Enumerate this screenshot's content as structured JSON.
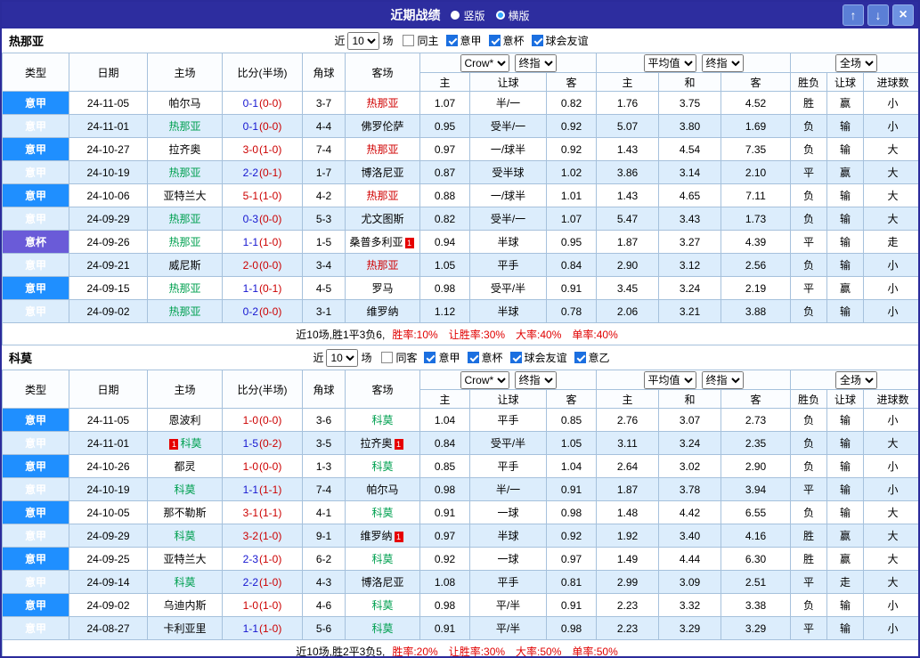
{
  "titlebar": {
    "title": "近期战绩",
    "view_options": [
      {
        "label": "竖版",
        "selected": false
      },
      {
        "label": "横版",
        "selected": true
      }
    ],
    "up_icon": "↑",
    "down_icon": "↓",
    "close_icon": "×"
  },
  "columns": {
    "main": [
      "类型",
      "日期",
      "主场",
      "比分(半场)",
      "角球",
      "客场"
    ],
    "sub": [
      "主",
      "让球",
      "客",
      "主",
      "和",
      "客",
      "胜负",
      "让球",
      "进球数"
    ]
  },
  "sections": [
    {
      "team": "热那亚",
      "filter": {
        "prefix": "近",
        "count": "10",
        "suffix": "场",
        "checkboxes": [
          {
            "label": "同主",
            "checked": false
          },
          {
            "label": "意甲",
            "checked": true
          },
          {
            "label": "意杯",
            "checked": true
          },
          {
            "label": "球会友谊",
            "checked": true
          }
        ]
      },
      "dropdowns": {
        "source": "Crow*",
        "period1": "终指",
        "average": "平均值",
        "period2": "终指",
        "scope": "全场"
      },
      "rows": [
        {
          "type": "意甲",
          "type_color": "blue",
          "date": "24-11-05",
          "home": "帕尔马",
          "home_color": "black",
          "home_badge": null,
          "score_ft": "0-1",
          "score_ht": "(0-0)",
          "ft_color": "blue",
          "corner": "3-7",
          "away": "热那亚",
          "away_color": "red",
          "away_badge": null,
          "odds": [
            "1.07",
            "半/一",
            "0.82"
          ],
          "avg": [
            "1.76",
            "3.75",
            "4.52"
          ],
          "results": [
            {
              "text": "胜",
              "color": "red"
            },
            {
              "text": "赢",
              "color": "red"
            },
            {
              "text": "小",
              "color": "green"
            }
          ]
        },
        {
          "type": "意甲",
          "type_color": "blue",
          "date": "24-11-01",
          "home": "热那亚",
          "home_color": "green",
          "home_badge": null,
          "score_ft": "0-1",
          "score_ht": "(0-0)",
          "ft_color": "blue",
          "corner": "4-4",
          "away": "佛罗伦萨",
          "away_color": "black",
          "away_badge": null,
          "odds": [
            "0.95",
            "受半/一",
            "0.92"
          ],
          "avg": [
            "5.07",
            "3.80",
            "1.69"
          ],
          "results": [
            {
              "text": "负",
              "color": "green"
            },
            {
              "text": "输",
              "color": "green"
            },
            {
              "text": "小",
              "color": "green"
            }
          ]
        },
        {
          "type": "意甲",
          "type_color": "blue",
          "date": "24-10-27",
          "home": "拉齐奥",
          "home_color": "black",
          "home_badge": null,
          "score_ft": "3-0",
          "score_ht": "(1-0)",
          "ft_color": "red",
          "corner": "7-4",
          "away": "热那亚",
          "away_color": "red",
          "away_badge": null,
          "odds": [
            "0.97",
            "一/球半",
            "0.92"
          ],
          "avg": [
            "1.43",
            "4.54",
            "7.35"
          ],
          "results": [
            {
              "text": "负",
              "color": "green"
            },
            {
              "text": "输",
              "color": "green"
            },
            {
              "text": "大",
              "color": "red"
            }
          ]
        },
        {
          "type": "意甲",
          "type_color": "blue",
          "date": "24-10-19",
          "home": "热那亚",
          "home_color": "green",
          "home_badge": null,
          "score_ft": "2-2",
          "score_ht": "(0-1)",
          "ft_color": "blue",
          "corner": "1-7",
          "away": "博洛尼亚",
          "away_color": "black",
          "away_badge": null,
          "odds": [
            "0.87",
            "受半球",
            "1.02"
          ],
          "avg": [
            "3.86",
            "3.14",
            "2.10"
          ],
          "results": [
            {
              "text": "平",
              "color": "blue"
            },
            {
              "text": "赢",
              "color": "red"
            },
            {
              "text": "大",
              "color": "red"
            }
          ]
        },
        {
          "type": "意甲",
          "type_color": "blue",
          "date": "24-10-06",
          "home": "亚特兰大",
          "home_color": "black",
          "home_badge": null,
          "score_ft": "5-1",
          "score_ht": "(1-0)",
          "ft_color": "red",
          "corner": "4-2",
          "away": "热那亚",
          "away_color": "red",
          "away_badge": null,
          "odds": [
            "0.88",
            "一/球半",
            "1.01"
          ],
          "avg": [
            "1.43",
            "4.65",
            "7.11"
          ],
          "results": [
            {
              "text": "负",
              "color": "green"
            },
            {
              "text": "输",
              "color": "green"
            },
            {
              "text": "大",
              "color": "red"
            }
          ]
        },
        {
          "type": "意甲",
          "type_color": "blue",
          "date": "24-09-29",
          "home": "热那亚",
          "home_color": "green",
          "home_badge": null,
          "score_ft": "0-3",
          "score_ht": "(0-0)",
          "ft_color": "blue",
          "corner": "5-3",
          "away": "尤文图斯",
          "away_color": "black",
          "away_badge": null,
          "odds": [
            "0.82",
            "受半/一",
            "1.07"
          ],
          "avg": [
            "5.47",
            "3.43",
            "1.73"
          ],
          "results": [
            {
              "text": "负",
              "color": "green"
            },
            {
              "text": "输",
              "color": "green"
            },
            {
              "text": "大",
              "color": "red"
            }
          ]
        },
        {
          "type": "意杯",
          "type_color": "purple",
          "date": "24-09-26",
          "home": "热那亚",
          "home_color": "green",
          "home_badge": null,
          "score_ft": "1-1",
          "score_ht": "(1-0)",
          "ft_color": "blue",
          "corner": "1-5",
          "away": "桑普多利亚",
          "away_color": "black",
          "away_badge": "1",
          "odds": [
            "0.94",
            "半球",
            "0.95"
          ],
          "avg": [
            "1.87",
            "3.27",
            "4.39"
          ],
          "results": [
            {
              "text": "平",
              "color": "blue"
            },
            {
              "text": "输",
              "color": "green"
            },
            {
              "text": "走",
              "color": "blue"
            }
          ]
        },
        {
          "type": "意甲",
          "type_color": "blue",
          "date": "24-09-21",
          "home": "威尼斯",
          "home_color": "black",
          "home_badge": null,
          "score_ft": "2-0",
          "score_ht": "(0-0)",
          "ft_color": "red",
          "corner": "3-4",
          "away": "热那亚",
          "away_color": "red",
          "away_badge": null,
          "odds": [
            "1.05",
            "平手",
            "0.84"
          ],
          "avg": [
            "2.90",
            "3.12",
            "2.56"
          ],
          "results": [
            {
              "text": "负",
              "color": "green"
            },
            {
              "text": "输",
              "color": "green"
            },
            {
              "text": "小",
              "color": "green"
            }
          ]
        },
        {
          "type": "意甲",
          "type_color": "blue",
          "date": "24-09-15",
          "home": "热那亚",
          "home_color": "green",
          "home_badge": null,
          "score_ft": "1-1",
          "score_ht": "(0-1)",
          "ft_color": "blue",
          "corner": "4-5",
          "away": "罗马",
          "away_color": "black",
          "away_badge": null,
          "odds": [
            "0.98",
            "受平/半",
            "0.91"
          ],
          "avg": [
            "3.45",
            "3.24",
            "2.19"
          ],
          "results": [
            {
              "text": "平",
              "color": "blue"
            },
            {
              "text": "赢",
              "color": "red"
            },
            {
              "text": "小",
              "color": "green"
            }
          ]
        },
        {
          "type": "意甲",
          "type_color": "blue",
          "date": "24-09-02",
          "home": "热那亚",
          "home_color": "green",
          "home_badge": null,
          "score_ft": "0-2",
          "score_ht": "(0-0)",
          "ft_color": "blue",
          "corner": "3-1",
          "away": "维罗纳",
          "away_color": "black",
          "away_badge": null,
          "odds": [
            "1.12",
            "半球",
            "0.78"
          ],
          "avg": [
            "2.06",
            "3.21",
            "3.88"
          ],
          "results": [
            {
              "text": "负",
              "color": "green"
            },
            {
              "text": "输",
              "color": "green"
            },
            {
              "text": "小",
              "color": "green"
            }
          ]
        }
      ],
      "summary": {
        "prefix": "近10场,胜1平3负6,",
        "rates": [
          "胜率:10%",
          "让胜率:30%",
          "大率:40%",
          "单率:40%"
        ]
      }
    },
    {
      "team": "科莫",
      "filter": {
        "prefix": "近",
        "count": "10",
        "suffix": "场",
        "checkboxes": [
          {
            "label": "同客",
            "checked": false
          },
          {
            "label": "意甲",
            "checked": true
          },
          {
            "label": "意杯",
            "checked": true
          },
          {
            "label": "球会友谊",
            "checked": true
          },
          {
            "label": "意乙",
            "checked": true
          }
        ]
      },
      "dropdowns": {
        "source": "Crow*",
        "period1": "终指",
        "average": "平均值",
        "period2": "终指",
        "scope": "全场"
      },
      "rows": [
        {
          "type": "意甲",
          "type_color": "blue",
          "date": "24-11-05",
          "home": "恩波利",
          "home_color": "black",
          "home_badge": null,
          "score_ft": "1-0",
          "score_ht": "(0-0)",
          "ft_color": "red",
          "corner": "3-6",
          "away": "科莫",
          "away_color": "green",
          "away_badge": null,
          "odds": [
            "1.04",
            "平手",
            "0.85"
          ],
          "avg": [
            "2.76",
            "3.07",
            "2.73"
          ],
          "results": [
            {
              "text": "负",
              "color": "green"
            },
            {
              "text": "输",
              "color": "green"
            },
            {
              "text": "小",
              "color": "green"
            }
          ]
        },
        {
          "type": "意甲",
          "type_color": "blue",
          "date": "24-11-01",
          "home": "科莫",
          "home_color": "green",
          "home_badge": "1",
          "score_ft": "1-5",
          "score_ht": "(0-2)",
          "ft_color": "blue",
          "corner": "3-5",
          "away": "拉齐奥",
          "away_color": "black",
          "away_badge": "1",
          "odds": [
            "0.84",
            "受平/半",
            "1.05"
          ],
          "avg": [
            "3.11",
            "3.24",
            "2.35"
          ],
          "results": [
            {
              "text": "负",
              "color": "green"
            },
            {
              "text": "输",
              "color": "green"
            },
            {
              "text": "大",
              "color": "red"
            }
          ]
        },
        {
          "type": "意甲",
          "type_color": "blue",
          "date": "24-10-26",
          "home": "都灵",
          "home_color": "black",
          "home_badge": null,
          "score_ft": "1-0",
          "score_ht": "(0-0)",
          "ft_color": "red",
          "corner": "1-3",
          "away": "科莫",
          "away_color": "green",
          "away_badge": null,
          "odds": [
            "0.85",
            "平手",
            "1.04"
          ],
          "avg": [
            "2.64",
            "3.02",
            "2.90"
          ],
          "results": [
            {
              "text": "负",
              "color": "green"
            },
            {
              "text": "输",
              "color": "green"
            },
            {
              "text": "小",
              "color": "green"
            }
          ]
        },
        {
          "type": "意甲",
          "type_color": "blue",
          "date": "24-10-19",
          "home": "科莫",
          "home_color": "green",
          "home_badge": null,
          "score_ft": "1-1",
          "score_ht": "(1-1)",
          "ft_color": "blue",
          "corner": "7-4",
          "away": "帕尔马",
          "away_color": "black",
          "away_badge": null,
          "odds": [
            "0.98",
            "半/一",
            "0.91"
          ],
          "avg": [
            "1.87",
            "3.78",
            "3.94"
          ],
          "results": [
            {
              "text": "平",
              "color": "blue"
            },
            {
              "text": "输",
              "color": "green"
            },
            {
              "text": "小",
              "color": "green"
            }
          ]
        },
        {
          "type": "意甲",
          "type_color": "blue",
          "date": "24-10-05",
          "home": "那不勒斯",
          "home_color": "black",
          "home_badge": null,
          "score_ft": "3-1",
          "score_ht": "(1-1)",
          "ft_color": "red",
          "corner": "4-1",
          "away": "科莫",
          "away_color": "green",
          "away_badge": null,
          "odds": [
            "0.91",
            "一球",
            "0.98"
          ],
          "avg": [
            "1.48",
            "4.42",
            "6.55"
          ],
          "results": [
            {
              "text": "负",
              "color": "green"
            },
            {
              "text": "输",
              "color": "green"
            },
            {
              "text": "大",
              "color": "red"
            }
          ]
        },
        {
          "type": "意甲",
          "type_color": "blue",
          "date": "24-09-29",
          "home": "科莫",
          "home_color": "green",
          "home_badge": null,
          "score_ft": "3-2",
          "score_ht": "(1-0)",
          "ft_color": "red",
          "corner": "9-1",
          "away": "维罗纳",
          "away_color": "black",
          "away_badge": "1",
          "odds": [
            "0.97",
            "半球",
            "0.92"
          ],
          "avg": [
            "1.92",
            "3.40",
            "4.16"
          ],
          "results": [
            {
              "text": "胜",
              "color": "red"
            },
            {
              "text": "赢",
              "color": "red"
            },
            {
              "text": "大",
              "color": "red"
            }
          ]
        },
        {
          "type": "意甲",
          "type_color": "blue",
          "date": "24-09-25",
          "home": "亚特兰大",
          "home_color": "black",
          "home_badge": null,
          "score_ft": "2-3",
          "score_ht": "(1-0)",
          "ft_color": "blue",
          "corner": "6-2",
          "away": "科莫",
          "away_color": "green",
          "away_badge": null,
          "odds": [
            "0.92",
            "一球",
            "0.97"
          ],
          "avg": [
            "1.49",
            "4.44",
            "6.30"
          ],
          "results": [
            {
              "text": "胜",
              "color": "red"
            },
            {
              "text": "赢",
              "color": "red"
            },
            {
              "text": "大",
              "color": "red"
            }
          ]
        },
        {
          "type": "意甲",
          "type_color": "blue",
          "date": "24-09-14",
          "home": "科莫",
          "home_color": "green",
          "home_badge": null,
          "score_ft": "2-2",
          "score_ht": "(1-0)",
          "ft_color": "blue",
          "corner": "4-3",
          "away": "博洛尼亚",
          "away_color": "black",
          "away_badge": null,
          "odds": [
            "1.08",
            "平手",
            "0.81"
          ],
          "avg": [
            "2.99",
            "3.09",
            "2.51"
          ],
          "results": [
            {
              "text": "平",
              "color": "blue"
            },
            {
              "text": "走",
              "color": "blue"
            },
            {
              "text": "大",
              "color": "red"
            }
          ]
        },
        {
          "type": "意甲",
          "type_color": "blue",
          "date": "24-09-02",
          "home": "乌迪内斯",
          "home_color": "black",
          "home_badge": null,
          "score_ft": "1-0",
          "score_ht": "(1-0)",
          "ft_color": "red",
          "corner": "4-6",
          "away": "科莫",
          "away_color": "green",
          "away_badge": null,
          "odds": [
            "0.98",
            "平/半",
            "0.91"
          ],
          "avg": [
            "2.23",
            "3.32",
            "3.38"
          ],
          "results": [
            {
              "text": "负",
              "color": "green"
            },
            {
              "text": "输",
              "color": "green"
            },
            {
              "text": "小",
              "color": "green"
            }
          ]
        },
        {
          "type": "意甲",
          "type_color": "blue",
          "date": "24-08-27",
          "home": "卡利亚里",
          "home_color": "black",
          "home_badge": null,
          "score_ft": "1-1",
          "score_ht": "(1-0)",
          "ft_color": "blue",
          "corner": "5-6",
          "away": "科莫",
          "away_color": "green",
          "away_badge": null,
          "odds": [
            "0.91",
            "平/半",
            "0.98"
          ],
          "avg": [
            "2.23",
            "3.29",
            "3.29"
          ],
          "results": [
            {
              "text": "平",
              "color": "blue"
            },
            {
              "text": "输",
              "color": "green"
            },
            {
              "text": "小",
              "color": "green"
            }
          ]
        }
      ],
      "summary": {
        "prefix": "近10场,胜2平3负5,",
        "rates": [
          "胜率:20%",
          "让胜率:30%",
          "大率:50%",
          "单率:50%"
        ]
      }
    }
  ]
}
